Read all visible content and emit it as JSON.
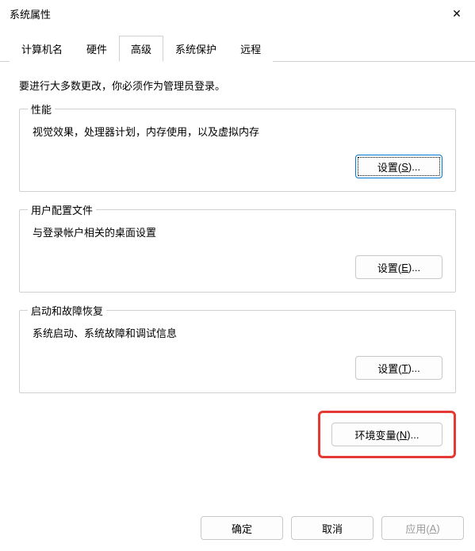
{
  "titlebar": {
    "title": "系统属性",
    "close": "✕"
  },
  "tabs": {
    "computer_name": "计算机名",
    "hardware": "硬件",
    "advanced": "高级",
    "system_protection": "系统保护",
    "remote": "远程"
  },
  "intro": "要进行大多数更改，你必须作为管理员登录。",
  "performance": {
    "legend": "性能",
    "desc": "视觉效果，处理器计划，内存使用，以及虚拟内存",
    "button_prefix": "设置(",
    "button_key": "S",
    "button_suffix": ")..."
  },
  "user_profiles": {
    "legend": "用户配置文件",
    "desc": "与登录帐户相关的桌面设置",
    "button_prefix": "设置(",
    "button_key": "E",
    "button_suffix": ")..."
  },
  "startup": {
    "legend": "启动和故障恢复",
    "desc": "系统启动、系统故障和调试信息",
    "button_prefix": "设置(",
    "button_key": "T",
    "button_suffix": ")..."
  },
  "env_vars": {
    "button_prefix": "环境变量(",
    "button_key": "N",
    "button_suffix": ")..."
  },
  "actions": {
    "ok": "确定",
    "cancel": "取消",
    "apply_prefix": "应用(",
    "apply_key": "A",
    "apply_suffix": ")"
  }
}
